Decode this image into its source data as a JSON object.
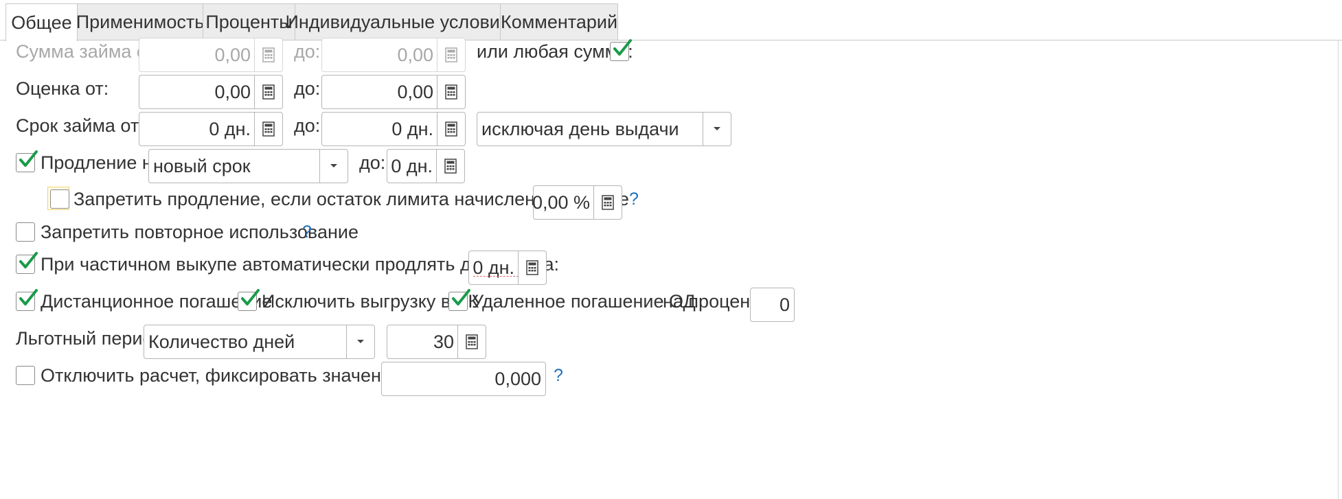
{
  "tabs": [
    {
      "label": "Общее",
      "active": true
    },
    {
      "label": "Применимость",
      "active": false
    },
    {
      "label": "Проценты",
      "active": false
    },
    {
      "label": "Индивидуальные условия",
      "active": false
    },
    {
      "label": "Комментарий",
      "active": false
    }
  ],
  "loan_sum": {
    "label": "Сумма займа от:",
    "from": "0,00",
    "to_label": "до:",
    "to": "0,00",
    "any_label": "или любая сумма:",
    "any_checked": true
  },
  "rating": {
    "label": "Оценка от:",
    "from": "0,00",
    "to_label": "до:",
    "to": "0,00"
  },
  "term": {
    "label": "Срок займа от:",
    "from": "0 дн.",
    "to_label": "до:",
    "to": "0 дн.",
    "mode": "исключая день выдачи"
  },
  "extension": {
    "checked": true,
    "label": "Продление на",
    "mode": "новый срок",
    "to_label": "до:",
    "to": "0 дн."
  },
  "forbid_extension": {
    "checked": false,
    "label": "Запретить продление, если остаток лимита начислений меньше",
    "value": "0,00 %",
    "help": "?"
  },
  "forbid_reuse": {
    "checked": false,
    "label": "Запретить повторное использование",
    "help": "?"
  },
  "partial_buyout": {
    "checked": true,
    "label": "При частичном выкупе автоматически продлять договор на:",
    "value": "0 дн."
  },
  "remote": {
    "distance_checked": true,
    "distance_label": "Дистанционное погашение",
    "exclude_checked": true,
    "exclude_label": "Исключить выгрузку в ЛК",
    "remote_od_checked": true,
    "remote_od_label": "Удаленное погашение ОД",
    "percent_label": "на процент:",
    "percent_value": "0"
  },
  "grace": {
    "label": "Льготный период:",
    "mode": "Количество дней",
    "value": "30"
  },
  "psk": {
    "checked": false,
    "label": "Отключить расчет, фиксировать значение ПСК:",
    "value": "0,000",
    "help": "?"
  },
  "colors": {
    "check": "#1a9a4a",
    "help": "#1f6fba",
    "accent_focus": "#f2d56e"
  }
}
